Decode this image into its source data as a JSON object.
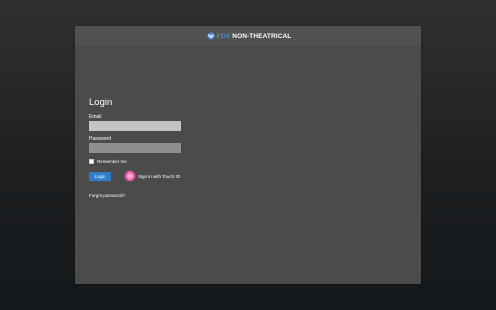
{
  "header": {
    "brand_fox": "FOX",
    "brand_rest": "NON-THEATRICAL",
    "logo_icon": "fox-globe-logo",
    "brand_color": "#4a90d9"
  },
  "form": {
    "title": "Login",
    "email_label": "Email",
    "email_value": "",
    "password_label": "Password",
    "password_value": "",
    "remember_label": "Remember me",
    "remember_checked": false,
    "login_button_label": "Login",
    "touch_id_label": "Sign in with Touch ID",
    "touch_id_icon": "fingerprint-icon",
    "forgot_password_label": "Forgot password?",
    "accent_color": "#2f7ec9",
    "touch_id_color": "#f35aa8"
  }
}
